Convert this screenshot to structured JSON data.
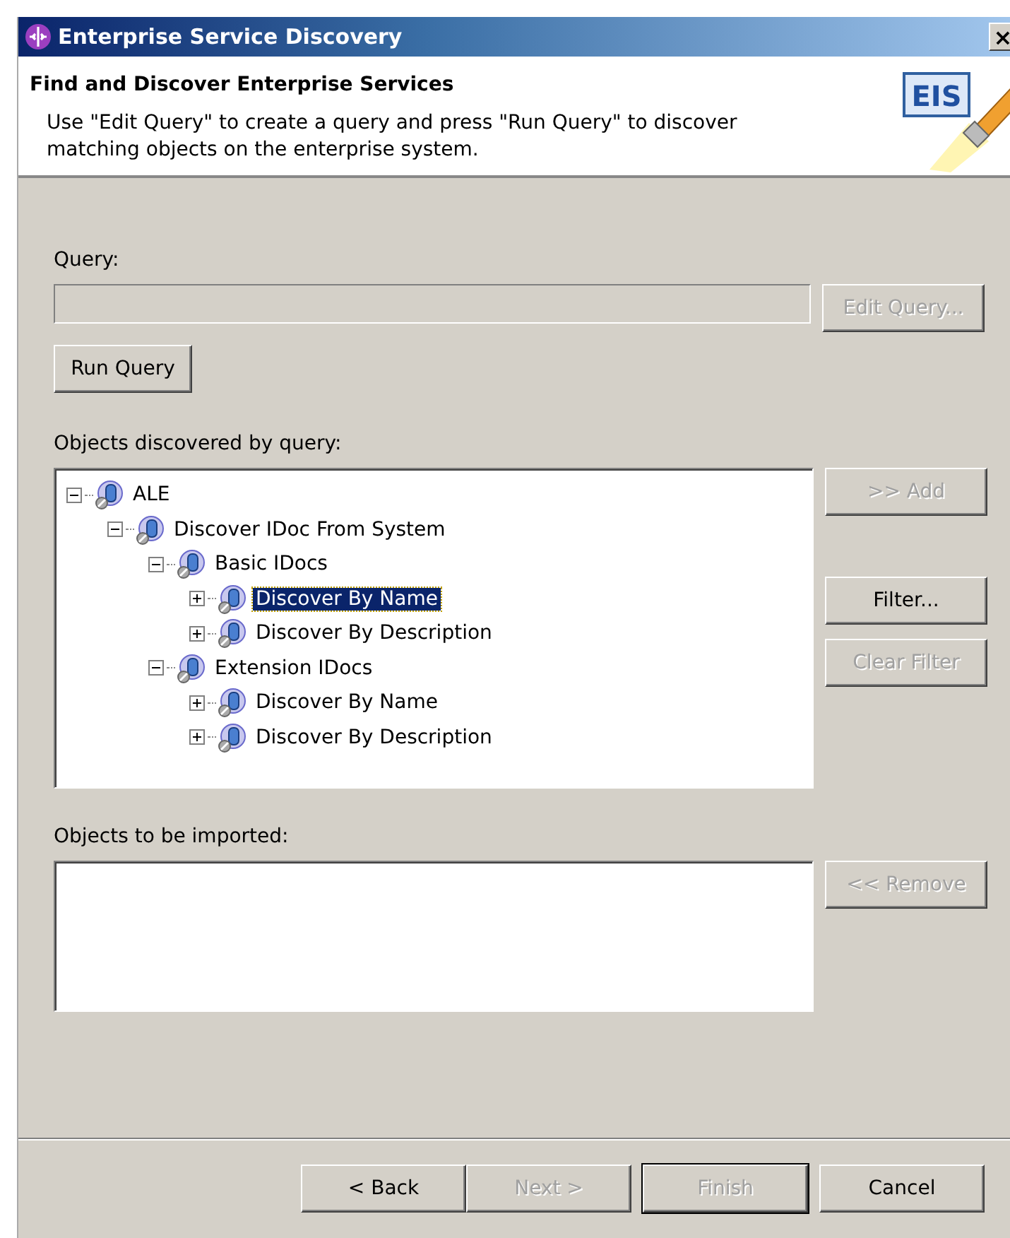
{
  "window": {
    "title": "Enterprise Service Discovery",
    "close": "×"
  },
  "header": {
    "title": "Find and Discover Enterprise Services",
    "description": "Use \"Edit Query\" to create a query and press \"Run Query\" to discover matching objects on the enterprise system.",
    "logo": "EIS"
  },
  "query": {
    "label": "Query:",
    "edit_button": {
      "label": "Edit Query...",
      "disabled": true
    },
    "run_button": {
      "label": "Run Query",
      "disabled": false
    }
  },
  "discovered": {
    "label": "Objects discovered by query:",
    "tree": [
      {
        "label": "ALE",
        "expanded": true,
        "selected": false,
        "children": [
          {
            "label": "Discover IDoc From System",
            "expanded": true,
            "selected": false,
            "children": [
              {
                "label": "Basic IDocs",
                "expanded": true,
                "selected": false,
                "children": [
                  {
                    "label": "Discover By Name",
                    "expanded": false,
                    "selected": true
                  },
                  {
                    "label": "Discover By Description",
                    "expanded": false,
                    "selected": false
                  }
                ]
              },
              {
                "label": "Extension IDocs",
                "expanded": true,
                "selected": false,
                "children": [
                  {
                    "label": "Discover By Name",
                    "expanded": false,
                    "selected": false
                  },
                  {
                    "label": "Discover By Description",
                    "expanded": false,
                    "selected": false
                  }
                ]
              }
            ]
          }
        ]
      }
    ],
    "buttons": [
      {
        "label": ">> Add",
        "disabled": true
      },
      {
        "label": "Filter...",
        "disabled": false
      },
      {
        "label": "Clear Filter",
        "disabled": true
      }
    ]
  },
  "imported": {
    "label": "Objects to be imported:",
    "buttons": [
      {
        "label": "<< Remove",
        "disabled": true
      }
    ]
  },
  "footer_buttons": [
    {
      "label": "< Back",
      "disabled": false,
      "default": false
    },
    {
      "label": "Next >",
      "disabled": true,
      "default": false
    },
    {
      "label": "Finish",
      "disabled": true,
      "default": true
    },
    {
      "label": "Cancel",
      "disabled": false,
      "default": false
    }
  ]
}
